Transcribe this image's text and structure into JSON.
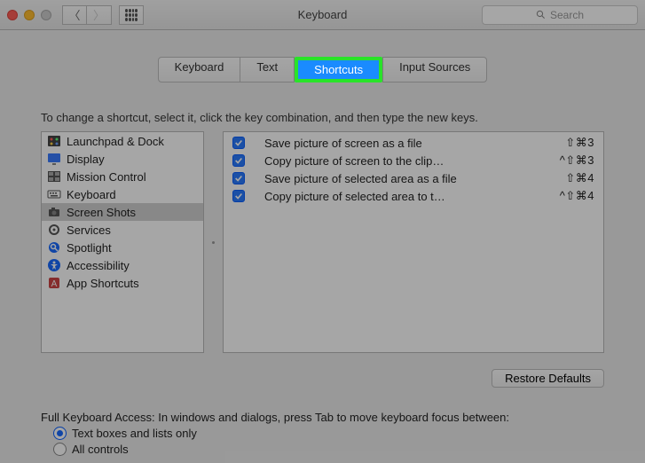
{
  "window": {
    "title": "Keyboard"
  },
  "search": {
    "placeholder": "Search"
  },
  "tabs": [
    {
      "label": "Keyboard"
    },
    {
      "label": "Text"
    },
    {
      "label": "Shortcuts",
      "active": true,
      "highlighted": true
    },
    {
      "label": "Input Sources"
    }
  ],
  "instruction": "To change a shortcut, select it, click the key combination, and then type the new keys.",
  "categories": [
    {
      "label": "Launchpad & Dock",
      "icon": "launchpad"
    },
    {
      "label": "Display",
      "icon": "display"
    },
    {
      "label": "Mission Control",
      "icon": "mission"
    },
    {
      "label": "Keyboard",
      "icon": "keyboard"
    },
    {
      "label": "Screen Shots",
      "icon": "camera",
      "selected": true
    },
    {
      "label": "Services",
      "icon": "gear"
    },
    {
      "label": "Spotlight",
      "icon": "spotlight"
    },
    {
      "label": "Accessibility",
      "icon": "accessibility"
    },
    {
      "label": "App Shortcuts",
      "icon": "app"
    }
  ],
  "shortcuts": [
    {
      "label": "Save picture of screen as a file",
      "key": "⇧⌘3",
      "checked": true
    },
    {
      "label": "Copy picture of screen to the clip…",
      "key": "^⇧⌘3",
      "checked": true
    },
    {
      "label": "Save picture of selected area as a file",
      "key": "⇧⌘4",
      "checked": true
    },
    {
      "label": "Copy picture of selected area to t…",
      "key": "^⇧⌘4",
      "checked": true
    }
  ],
  "restore_label": "Restore Defaults",
  "fka": {
    "intro": "Full Keyboard Access: In windows and dialogs, press Tab to move keyboard focus between:",
    "opt1": "Text boxes and lists only",
    "opt2": "All controls",
    "selected": 0
  }
}
